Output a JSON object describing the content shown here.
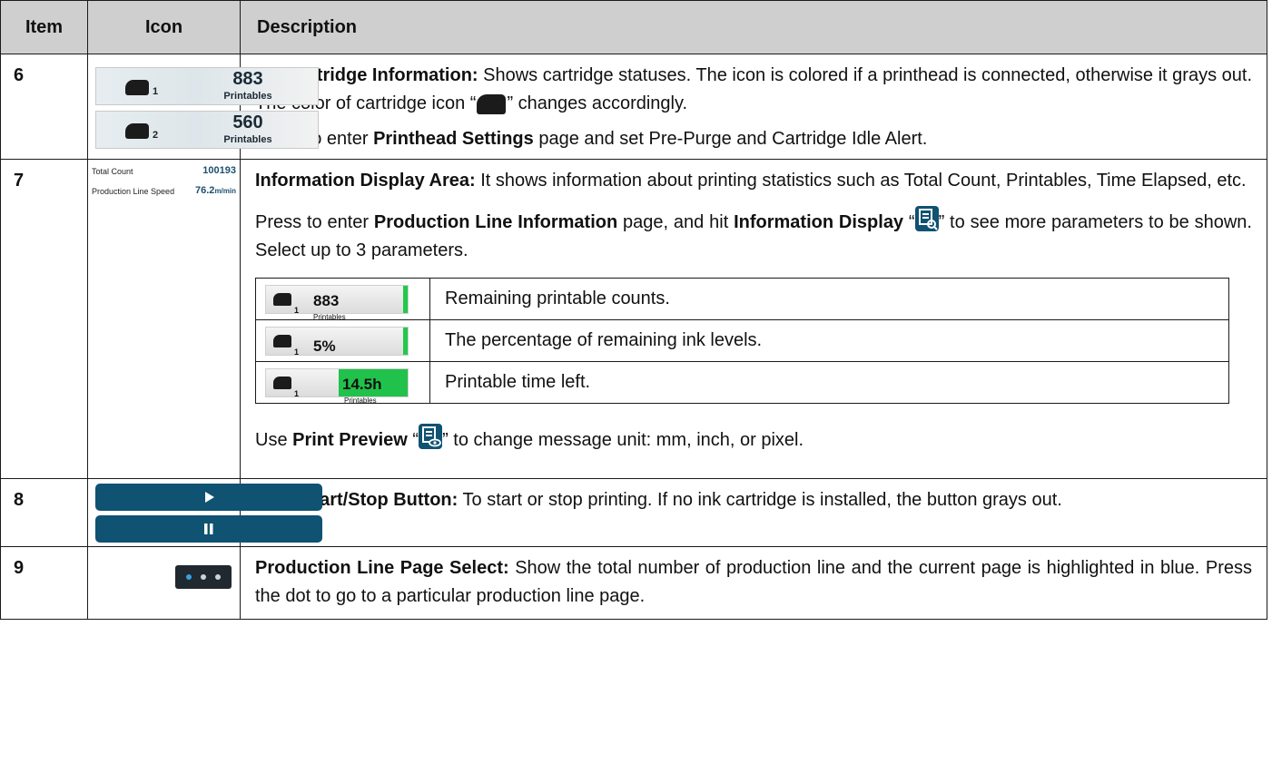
{
  "headers": {
    "item": "Item",
    "icon": "Icon",
    "description": "Description"
  },
  "rows": [
    {
      "item": "6",
      "icon": {
        "cartridges": [
          {
            "index": "1",
            "value": "883",
            "label": "Printables"
          },
          {
            "index": "2",
            "value": "560",
            "label": "Printables"
          }
        ]
      },
      "desc": {
        "p1_title": "Ink Cartridge Information:",
        "p1_text": " Shows cartridge statuses. The icon is colored if a printhead is connected, otherwise it grays out. The color of cartridge icon “",
        "p1_text2": "” changes accordingly.",
        "p2_a": "Press to enter ",
        "p2_b": "Printhead Settings",
        "p2_c": " page and set Pre-Purge and Cartridge Idle Alert."
      }
    },
    {
      "item": "7",
      "icon": {
        "stats": [
          {
            "label": "Total Count",
            "value": "100193",
            "unit": ""
          },
          {
            "label": "Production Line Speed",
            "value": "76.2",
            "unit": "m/min"
          }
        ]
      },
      "desc": {
        "p1_title": "Information Display Area:",
        "p1_text": " It shows information about printing statistics such as Total Count, Printables, Time Elapsed, etc.",
        "p2_a": "Press to enter ",
        "p2_b": "Production Line Information",
        "p2_c": " page, and hit ",
        "p2_d": "Information Display",
        "p2_e": " “",
        "p2_f": "” to see more parameters to be shown. Select up to 3 parameters.",
        "modes": [
          {
            "index": "1",
            "value": "883",
            "label": "Printables",
            "style": "bar",
            "text": "Remaining printable counts."
          },
          {
            "index": "1",
            "value": "5%",
            "label": "",
            "style": "bar",
            "text": "The percentage of remaining ink levels."
          },
          {
            "index": "1",
            "value": "14.5h",
            "label": "Printables",
            "style": "fill",
            "text": "Printable time left."
          }
        ],
        "p3_a": "Use ",
        "p3_b": "Print Preview",
        "p3_c": " “",
        "p3_d": "” to change message unit: mm, inch, or pixel."
      }
    },
    {
      "item": "8",
      "desc": {
        "p1_title": "Print Start/Stop Button:",
        "p1_text": " To start or stop printing. If no ink cartridge is installed, the button grays out."
      }
    },
    {
      "item": "9",
      "desc": {
        "p1_title": "Production Line Page Select:",
        "p1_text": " Show the total number of production line and the current page is highlighted in blue. Press the dot to go to a particular production line page."
      }
    }
  ],
  "colors": {
    "accent": "#0f5272",
    "green": "#20c24b",
    "header_bg": "#cfcfcf"
  }
}
